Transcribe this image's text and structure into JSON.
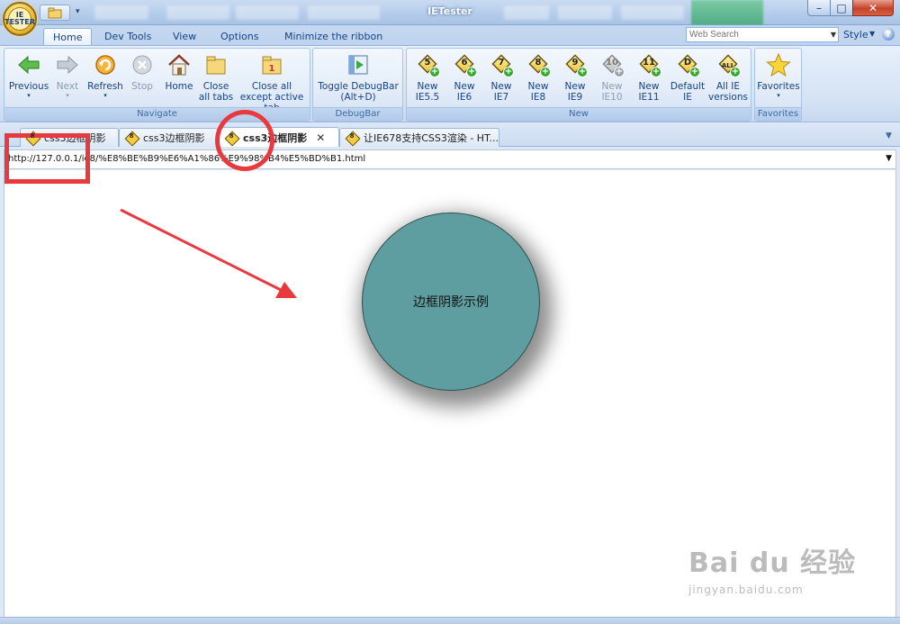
{
  "window": {
    "title": "IETester",
    "orb_text": "IE TESTER",
    "controls": {
      "minimize": "–",
      "maximize": "□",
      "close": "✕"
    }
  },
  "ribbon_tabs": [
    "Home",
    "Dev Tools",
    "View",
    "Options",
    "Minimize the ribbon"
  ],
  "search": {
    "placeholder": "Web Search"
  },
  "style_menu": "Style",
  "groups": {
    "navigate": {
      "label": "Navigate",
      "buttons": {
        "previous": "Previous",
        "next": "Next",
        "refresh": "Refresh",
        "stop": "Stop",
        "home": "Home",
        "close_all": "Close all tabs",
        "close_except": "Close all except active tab"
      }
    },
    "debugbar": {
      "label": "DebugBar",
      "toggle_line1": "Toggle DebugBar",
      "toggle_line2": "(Alt+D)"
    },
    "new": {
      "label": "New",
      "versions": [
        {
          "badge": "5",
          "line1": "New",
          "line2": "IE5.5"
        },
        {
          "badge": "6",
          "line1": "New",
          "line2": "IE6"
        },
        {
          "badge": "7",
          "line1": "New",
          "line2": "IE7"
        },
        {
          "badge": "8",
          "line1": "New",
          "line2": "IE8"
        },
        {
          "badge": "9",
          "line1": "New",
          "line2": "IE9"
        },
        {
          "badge": "10",
          "line1": "New",
          "line2": "IE10"
        },
        {
          "badge": "11",
          "line1": "New",
          "line2": "IE11"
        },
        {
          "badge": "D",
          "line1": "Default",
          "line2": "IE"
        },
        {
          "badge": "ALL",
          "line1": "All IE",
          "line2": "versions"
        }
      ]
    },
    "favorites": {
      "label": "Favorites",
      "button": "Favorites"
    }
  },
  "doc_tabs": [
    {
      "badge": "8",
      "label": "css3边框阴影"
    },
    {
      "badge": "8",
      "label": "css3边框阴影"
    },
    {
      "badge": "8",
      "label": "css3边框阴影"
    },
    {
      "badge": "8",
      "label": "让IE678支持CSS3渲染 - HT..."
    }
  ],
  "address": {
    "url": "http://127.0.0.1/ie8/%E8%BE%B9%E6%A1%86%E9%98%B4%E5%BD%B1.html"
  },
  "page": {
    "circle_text": "边框阴影示例"
  },
  "watermark": {
    "main": "Bai du 经验",
    "sub": "jingyan.baidu.com"
  },
  "colors": {
    "circle_fill": "#5f9ea0",
    "annotation": "#e8393f"
  }
}
